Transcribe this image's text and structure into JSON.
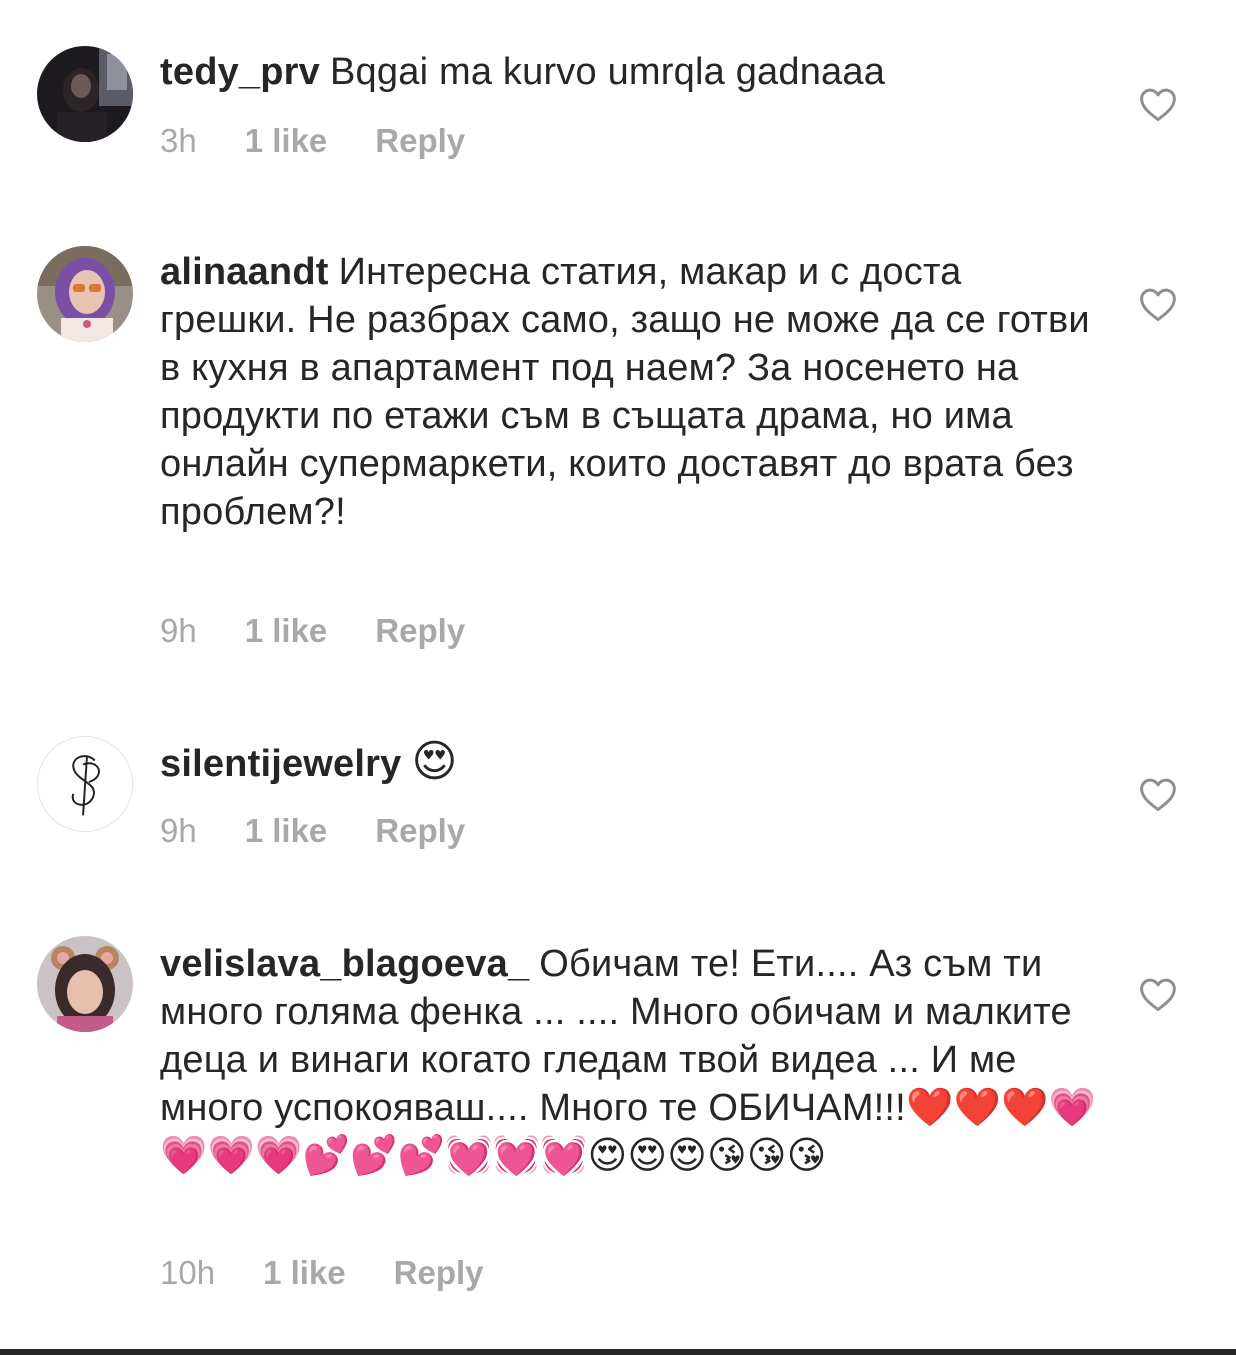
{
  "comments": [
    {
      "username": "tedy_prv",
      "text": "Bqgai ma kurvo umrqla gadnaaa",
      "time": "3h",
      "likes": "1 like",
      "reply": "Reply",
      "avatar_icon": "dark-portrait-avatar",
      "like_icon": "heart-outline-icon"
    },
    {
      "username": "alinaandt",
      "text": "Интересна статия, макар и с доста грешки. Не разбрах само, защо не може да се готви в кухня в апартамент под наем? За носенето на продукти по етажи съм в същата драма, но има онлайн супермаркети, които доставят до врата без проблем?!",
      "time": "9h",
      "likes": "1 like",
      "reply": "Reply",
      "avatar_icon": "purple-hair-portrait-avatar",
      "like_icon": "heart-outline-icon"
    },
    {
      "username": "silentijewelry",
      "text": "😍",
      "time": "9h",
      "likes": "1 like",
      "reply": "Reply",
      "avatar_icon": "sp-monogram-logo-avatar",
      "like_icon": "heart-outline-icon"
    },
    {
      "username": "velislava_blagoeva_",
      "text": "Обичам те! Ети.... Аз съм ти много голяма фенка ... .... Много обичам и малките деца и винаги когато гледам твой видеа ... И ме много успокояваш.... Много те ОБИЧАМ!!!❤️❤️❤️💗💗💗💗💕💕💕💓💓💓😍😍😍😘😘😘",
      "time": "10h",
      "likes": "1 like",
      "reply": "Reply",
      "avatar_icon": "bear-ears-filter-portrait-avatar",
      "like_icon": "heart-outline-icon"
    }
  ]
}
